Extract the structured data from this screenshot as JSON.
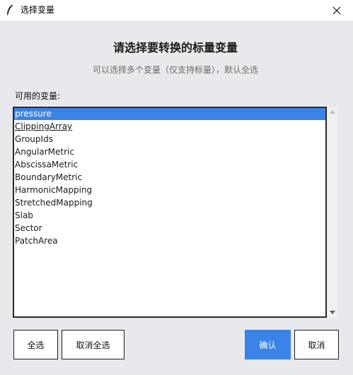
{
  "window": {
    "title": "选择变量",
    "icon": "feather-icon",
    "close_icon": "close-icon"
  },
  "dialog": {
    "heading": "请选择要转换的标量变量",
    "subheading": "可以选择多个变量（仅支持标量），默认全选",
    "list_label": "可用的变量:"
  },
  "variables": [
    {
      "label": "pressure",
      "selected": true
    },
    {
      "label": "ClippingArray",
      "selected": false,
      "active": true
    },
    {
      "label": "GroupIds",
      "selected": false
    },
    {
      "label": "AngularMetric",
      "selected": false
    },
    {
      "label": "AbscissaMetric",
      "selected": false
    },
    {
      "label": "BoundaryMetric",
      "selected": false
    },
    {
      "label": "HarmonicMapping",
      "selected": false
    },
    {
      "label": "StretchedMapping",
      "selected": false
    },
    {
      "label": "Slab",
      "selected": false
    },
    {
      "label": "Sector",
      "selected": false
    },
    {
      "label": "PatchArea",
      "selected": false
    }
  ],
  "buttons": {
    "select_all": "全选",
    "deselect_all": "取消全选",
    "confirm": "确认",
    "cancel": "取消"
  },
  "colors": {
    "accent": "#3b83e6",
    "background": "#e8e9ec"
  }
}
